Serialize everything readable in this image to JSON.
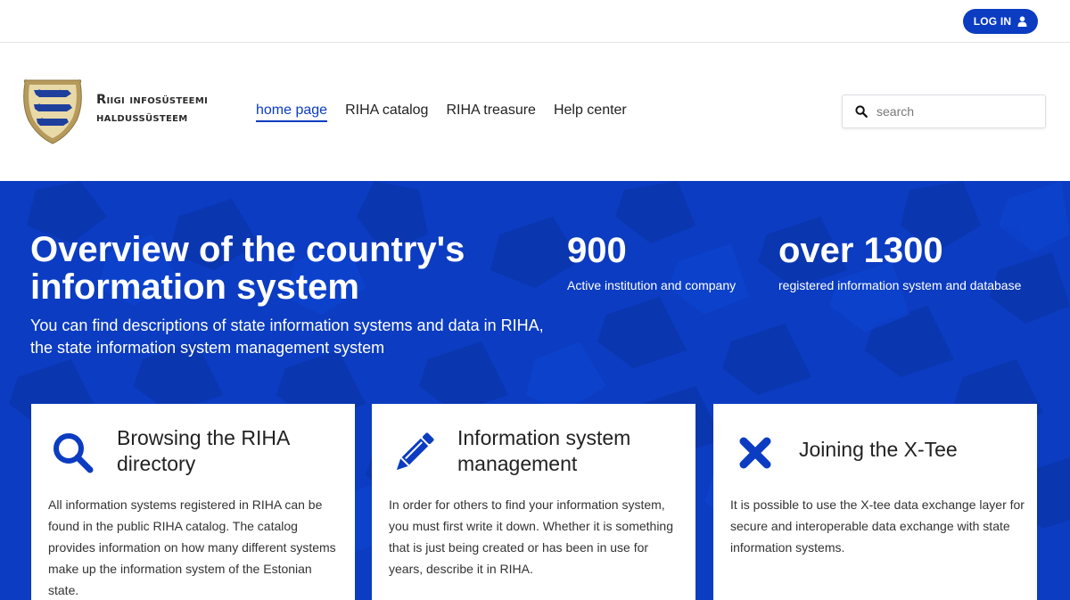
{
  "topbar": {
    "login_label": "LOG IN"
  },
  "header": {
    "logo_line1": "Riigi infosüsteemi",
    "logo_line2": "haldussüsteem",
    "nav": [
      {
        "label": "home page",
        "active": true
      },
      {
        "label": "RIHA catalog"
      },
      {
        "label": "RIHA treasure"
      },
      {
        "label": "Help center"
      }
    ],
    "search_placeholder": "search"
  },
  "hero": {
    "title": "Overview of the country's information system",
    "subtitle": "You can find descriptions of state information systems and data in RIHA, the state information system management system",
    "stats": [
      {
        "value": "900",
        "label": "Active institution and company"
      },
      {
        "value": "over 1300",
        "label": "registered information system and database"
      }
    ]
  },
  "cards": [
    {
      "icon": "search-icon",
      "title": "Browsing the RIHA directory",
      "text": "All information systems registered in RIHA can be found in the public RIHA catalog. The catalog provides information on how many different systems make up the information system of the Estonian state."
    },
    {
      "icon": "pencil-icon",
      "title": "Information system management",
      "text": "In order for others to find your information system, you must first write it down. Whether it is something that is just being created or has been in use for years, describe it in RIHA."
    },
    {
      "icon": "x-icon",
      "title": "Joining the X-Tee",
      "text": "It is possible to use the X-tee data exchange layer for secure and interoperable data exchange with state information systems."
    }
  ],
  "colors": {
    "brand_blue": "#0b3cc1",
    "crest_gold": "#b69a5c",
    "crest_blue": "#1f3f9c"
  }
}
